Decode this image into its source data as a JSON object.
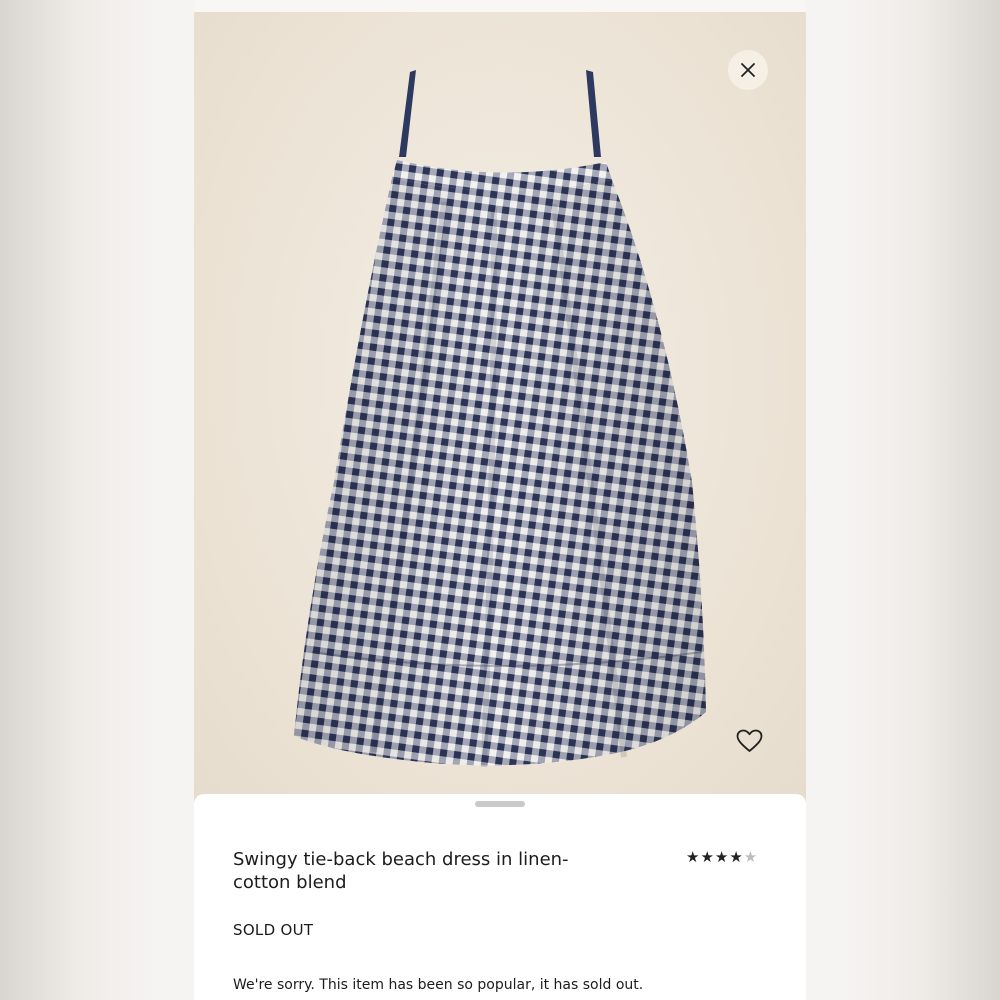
{
  "product": {
    "title": "Swingy tie-back beach dress in linen-cotton blend",
    "rating_stars": "★★★★",
    "rating_partial": "★",
    "rating_value": 4.5,
    "status": "SOLD OUT",
    "message": "We're sorry. This item has been so popular, it has sold out."
  },
  "icons": {
    "close": "close-icon",
    "favorite": "heart-icon"
  },
  "colors": {
    "hero_background": "#ebe2d4",
    "gingham_navy": "#2d3557",
    "gingham_white": "#f4f2ee",
    "strap": "#2e3960",
    "sheet_background": "#ffffff"
  }
}
